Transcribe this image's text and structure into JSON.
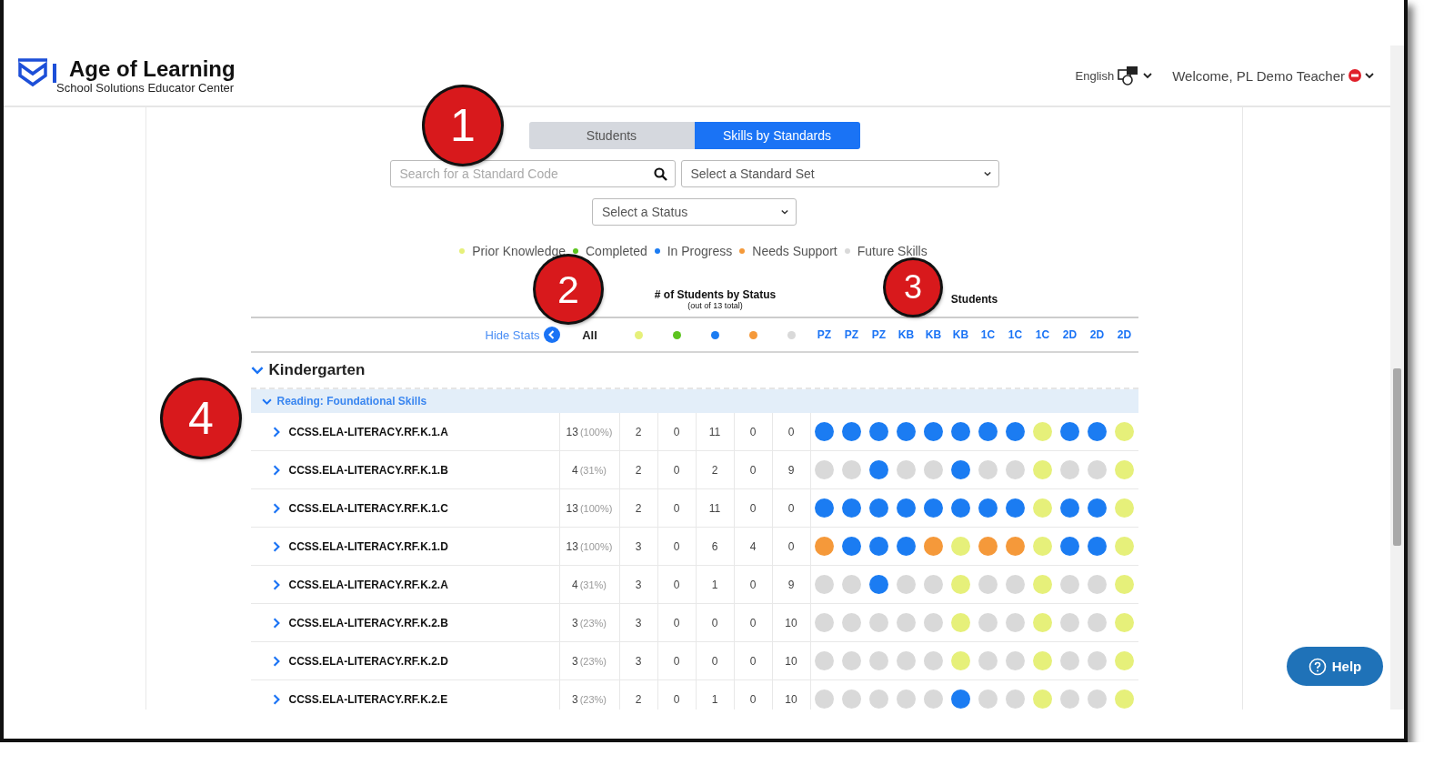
{
  "header": {
    "brand": "Age of Learning",
    "subtitle": "School Solutions Educator Center",
    "language": "English",
    "welcome": "Welcome, PL Demo Teacher"
  },
  "tabs": [
    {
      "label": "Students",
      "selected": false
    },
    {
      "label": "Skills by Standards",
      "selected": true
    }
  ],
  "search": {
    "placeholder": "Search for a Standard Code"
  },
  "standard_set": {
    "placeholder": "Select a Standard Set"
  },
  "status_filter": {
    "placeholder": "Select a Status"
  },
  "legend": [
    {
      "label": "Prior Knowledge",
      "color": "#e6f07a"
    },
    {
      "label": "Completed",
      "color": "#5dc41f"
    },
    {
      "label": "In Progress",
      "color": "#1b7cf2"
    },
    {
      "label": "Needs Support",
      "color": "#f5993a"
    },
    {
      "label": "Future Skills",
      "color": "#d9d9d9"
    }
  ],
  "stats_title": "# of Students by Status",
  "stats_subtitle": "(out of 13 total)",
  "students_title": "Students",
  "hide_stats": "Hide Stats",
  "all_label": "All",
  "student_columns": [
    "PZ",
    "PZ",
    "PZ",
    "KB",
    "KB",
    "KB",
    "1C",
    "1C",
    "1C",
    "2D",
    "2D",
    "2D"
  ],
  "grade": {
    "label": "Kindergarten",
    "expanded": true
  },
  "domain": {
    "label": "Reading: Foundational Skills",
    "expanded": true
  },
  "rows": [
    {
      "code": "CCSS.ELA-LITERACY.RF.K.1.A",
      "count": "13",
      "percent": "(100%)",
      "stats": [
        "2",
        "0",
        "11",
        "0",
        "0"
      ],
      "dots": [
        {
          "color": "#1b7cf2"
        },
        {
          "color": "#1b7cf2"
        },
        {
          "color": "#1b7cf2"
        },
        {
          "color": "#1b7cf2"
        },
        {
          "color": "#1b7cf2"
        },
        {
          "color": "#1b7cf2"
        },
        {
          "color": "#1b7cf2"
        },
        {
          "color": "#1b7cf2"
        },
        {
          "color": "#e6f07a"
        },
        {
          "color": "#1b7cf2"
        },
        {
          "color": "#1b7cf2"
        },
        {
          "color": "#e6f07a"
        }
      ]
    },
    {
      "code": "CCSS.ELA-LITERACY.RF.K.1.B",
      "count": "4",
      "percent": "(31%)",
      "stats": [
        "2",
        "0",
        "2",
        "0",
        "9"
      ],
      "dots": [
        {
          "color": "#d9d9d9"
        },
        {
          "color": "#d9d9d9"
        },
        {
          "color": "#1b7cf2"
        },
        {
          "color": "#d9d9d9"
        },
        {
          "color": "#d9d9d9"
        },
        {
          "color": "#1b7cf2"
        },
        {
          "color": "#d9d9d9"
        },
        {
          "color": "#d9d9d9"
        },
        {
          "color": "#e6f07a"
        },
        {
          "color": "#d9d9d9"
        },
        {
          "color": "#d9d9d9"
        },
        {
          "color": "#e6f07a"
        }
      ]
    },
    {
      "code": "CCSS.ELA-LITERACY.RF.K.1.C",
      "count": "13",
      "percent": "(100%)",
      "stats": [
        "2",
        "0",
        "11",
        "0",
        "0"
      ],
      "dots": [
        {
          "color": "#1b7cf2"
        },
        {
          "color": "#1b7cf2"
        },
        {
          "color": "#1b7cf2"
        },
        {
          "color": "#1b7cf2"
        },
        {
          "color": "#1b7cf2"
        },
        {
          "color": "#1b7cf2"
        },
        {
          "color": "#1b7cf2"
        },
        {
          "color": "#1b7cf2"
        },
        {
          "color": "#e6f07a"
        },
        {
          "color": "#1b7cf2"
        },
        {
          "color": "#1b7cf2"
        },
        {
          "color": "#e6f07a"
        }
      ]
    },
    {
      "code": "CCSS.ELA-LITERACY.RF.K.1.D",
      "count": "13",
      "percent": "(100%)",
      "stats": [
        "3",
        "0",
        "6",
        "4",
        "0"
      ],
      "dots": [
        {
          "color": "#f5993a"
        },
        {
          "color": "#1b7cf2"
        },
        {
          "color": "#1b7cf2"
        },
        {
          "color": "#1b7cf2"
        },
        {
          "color": "#f5993a"
        },
        {
          "color": "#e6f07a"
        },
        {
          "color": "#f5993a"
        },
        {
          "color": "#f5993a"
        },
        {
          "color": "#e6f07a"
        },
        {
          "color": "#1b7cf2"
        },
        {
          "color": "#1b7cf2"
        },
        {
          "color": "#e6f07a"
        }
      ]
    },
    {
      "code": "CCSS.ELA-LITERACY.RF.K.2.A",
      "count": "4",
      "percent": "(31%)",
      "stats": [
        "3",
        "0",
        "1",
        "0",
        "9"
      ],
      "dots": [
        {
          "color": "#d9d9d9"
        },
        {
          "color": "#d9d9d9"
        },
        {
          "color": "#1b7cf2"
        },
        {
          "color": "#d9d9d9"
        },
        {
          "color": "#d9d9d9"
        },
        {
          "color": "#e6f07a"
        },
        {
          "color": "#d9d9d9"
        },
        {
          "color": "#d9d9d9"
        },
        {
          "color": "#e6f07a"
        },
        {
          "color": "#d9d9d9"
        },
        {
          "color": "#d9d9d9"
        },
        {
          "color": "#e6f07a"
        }
      ]
    },
    {
      "code": "CCSS.ELA-LITERACY.RF.K.2.B",
      "count": "3",
      "percent": "(23%)",
      "stats": [
        "3",
        "0",
        "0",
        "0",
        "10"
      ],
      "dots": [
        {
          "color": "#d9d9d9"
        },
        {
          "color": "#d9d9d9"
        },
        {
          "color": "#d9d9d9"
        },
        {
          "color": "#d9d9d9"
        },
        {
          "color": "#d9d9d9"
        },
        {
          "color": "#e6f07a"
        },
        {
          "color": "#d9d9d9"
        },
        {
          "color": "#d9d9d9"
        },
        {
          "color": "#e6f07a"
        },
        {
          "color": "#d9d9d9"
        },
        {
          "color": "#d9d9d9"
        },
        {
          "color": "#e6f07a"
        }
      ]
    },
    {
      "code": "CCSS.ELA-LITERACY.RF.K.2.D",
      "count": "3",
      "percent": "(23%)",
      "stats": [
        "3",
        "0",
        "0",
        "0",
        "10"
      ],
      "dots": [
        {
          "color": "#d9d9d9"
        },
        {
          "color": "#d9d9d9"
        },
        {
          "color": "#d9d9d9"
        },
        {
          "color": "#d9d9d9"
        },
        {
          "color": "#d9d9d9"
        },
        {
          "color": "#e6f07a"
        },
        {
          "color": "#d9d9d9"
        },
        {
          "color": "#d9d9d9"
        },
        {
          "color": "#e6f07a"
        },
        {
          "color": "#d9d9d9"
        },
        {
          "color": "#d9d9d9"
        },
        {
          "color": "#e6f07a"
        }
      ]
    },
    {
      "code": "CCSS.ELA-LITERACY.RF.K.2.E",
      "count": "3",
      "percent": "(23%)",
      "stats": [
        "2",
        "0",
        "1",
        "0",
        "10"
      ],
      "dots": [
        {
          "color": "#d9d9d9"
        },
        {
          "color": "#d9d9d9"
        },
        {
          "color": "#d9d9d9"
        },
        {
          "color": "#d9d9d9"
        },
        {
          "color": "#d9d9d9"
        },
        {
          "color": "#1b7cf2"
        },
        {
          "color": "#d9d9d9"
        },
        {
          "color": "#d9d9d9"
        },
        {
          "color": "#e6f07a"
        },
        {
          "color": "#d9d9d9"
        },
        {
          "color": "#d9d9d9"
        },
        {
          "color": "#e6f07a"
        }
      ]
    }
  ],
  "callouts": [
    "1",
    "2",
    "3",
    "4"
  ],
  "help": "Help"
}
